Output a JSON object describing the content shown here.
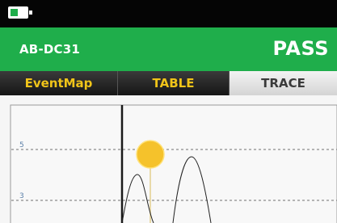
{
  "status_bar": {
    "battery_icon": "battery-icon"
  },
  "header": {
    "device_id": "AB-DC31",
    "result": "PASS"
  },
  "tabs": [
    {
      "label": "EventMap",
      "active": false
    },
    {
      "label": "TABLE",
      "active": false
    },
    {
      "label": "TRACE",
      "active": true
    }
  ],
  "trace": {
    "y_ticks": [
      "5",
      "3"
    ],
    "cursor_marker_color": "#f5c22b",
    "trace_color": "#222222"
  },
  "colors": {
    "header_green": "#1fae4b",
    "tab_inactive_text": "#f0c419"
  }
}
